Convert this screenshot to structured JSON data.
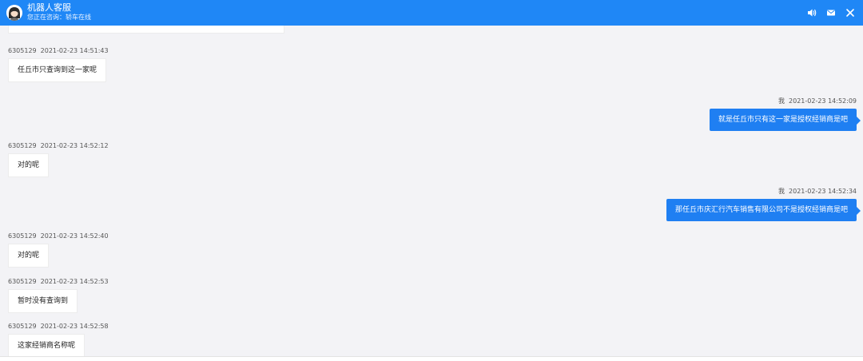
{
  "header": {
    "title": "机器人客服",
    "subtitle": "您正在咨询：轿车在线",
    "icons": [
      "volume-icon",
      "message-icon",
      "close-icon"
    ],
    "color": "#1f87f6"
  },
  "messages": [
    {
      "side": "left",
      "sender": "6305129",
      "time": "2021-02-23 14:51:43",
      "text": "任丘市只查询到这一家呢"
    },
    {
      "side": "right",
      "sender": "我",
      "time": "2021-02-23 14:52:09",
      "text": "就是任丘市只有这一家是授权经销商是吧"
    },
    {
      "side": "left",
      "sender": "6305129",
      "time": "2021-02-23 14:52:12",
      "text": "对的呢"
    },
    {
      "side": "right",
      "sender": "我",
      "time": "2021-02-23 14:52:34",
      "text": "那任丘市庆汇行汽车销售有限公司不是授权经销商是吧"
    },
    {
      "side": "left",
      "sender": "6305129",
      "time": "2021-02-23 14:52:40",
      "text": "对的呢"
    },
    {
      "side": "left",
      "sender": "6305129",
      "time": "2021-02-23 14:52:53",
      "text": "暂时没有查询到"
    },
    {
      "side": "left",
      "sender": "6305129",
      "time": "2021-02-23 14:52:58",
      "text": "这家经销商名称呢"
    }
  ],
  "colors": {
    "background": "#f3f3f6",
    "agent_bubble": "#ffffff",
    "user_bubble": "#1f7ff2"
  }
}
